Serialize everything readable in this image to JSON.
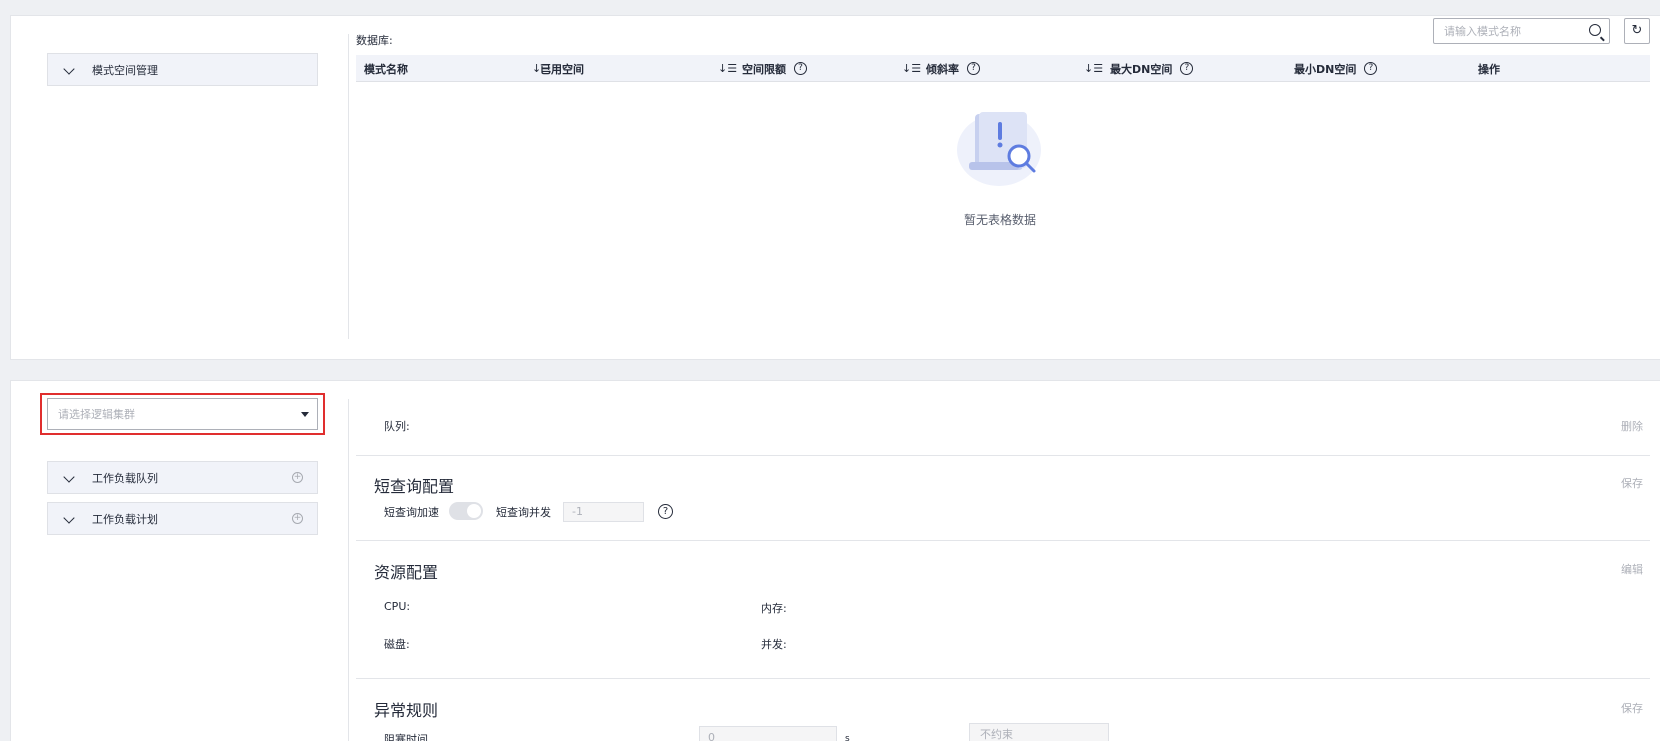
{
  "top": {
    "tree_item": "模式空间管理",
    "db_label": "数据库:",
    "search": {
      "placeholder": "请输入模式名称"
    },
    "refresh_icon": "↻",
    "columns": [
      {
        "label": "模式名称",
        "sortable": true,
        "help": false
      },
      {
        "label": "已用空间",
        "sortable": true,
        "help": false
      },
      {
        "label": "空间限额",
        "sortable": true,
        "help": true
      },
      {
        "label": "倾斜率",
        "sortable": true,
        "help": true
      },
      {
        "label": "最大DN空间",
        "sortable": false,
        "help": true
      },
      {
        "label": "最小DN空间",
        "sortable": false,
        "help": true
      },
      {
        "label": "操作",
        "sortable": false,
        "help": false
      }
    ],
    "sort_glyph": "↓☰",
    "help_glyph": "?",
    "empty_text": "暂无表格数据"
  },
  "bottom": {
    "cluster_select": {
      "placeholder": "请选择逻辑集群"
    },
    "tree_items": [
      "工作负载队列",
      "工作负载计划"
    ],
    "add_glyph": "+",
    "queue_label": "队列:",
    "delete_label": "删除",
    "short_query": {
      "title": "短查询配置",
      "save": "保存",
      "accel_label": "短查询加速",
      "concurrency_label": "短查询并发",
      "concurrency_value": "-1"
    },
    "resource": {
      "title": "资源配置",
      "edit": "编辑",
      "cpu_label": "CPU:",
      "memory_label": "内存:",
      "disk_label": "磁盘:",
      "concurrency_label": "并发:"
    },
    "exception": {
      "title": "异常规则",
      "save": "保存",
      "block_time_label": "阻塞时间",
      "block_time_value": "0",
      "unit": "s",
      "constraint_value": "不约束"
    }
  },
  "colors": {
    "highlight": "#e02e2e",
    "header_bg": "#f1f3f9",
    "muted": "#adb0b8"
  }
}
